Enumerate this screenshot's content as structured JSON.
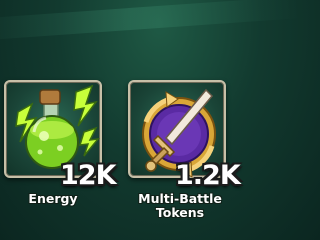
{
  "rewards": [
    {
      "label": "Energy",
      "amount": "12K",
      "icon": "energy-potion-icon"
    },
    {
      "label": "Multi-Battle Tokens",
      "label_lines": [
        "Multi-Battle",
        "Tokens"
      ],
      "amount": "1.2K",
      "icon": "multi-battle-token-icon"
    }
  ],
  "colors": {
    "background": "#123a2f",
    "card_border": "#c7c0a8",
    "potion_green": "#8bd42c",
    "token_purple": "#5a2aa3",
    "token_gold": "#d9a637"
  }
}
